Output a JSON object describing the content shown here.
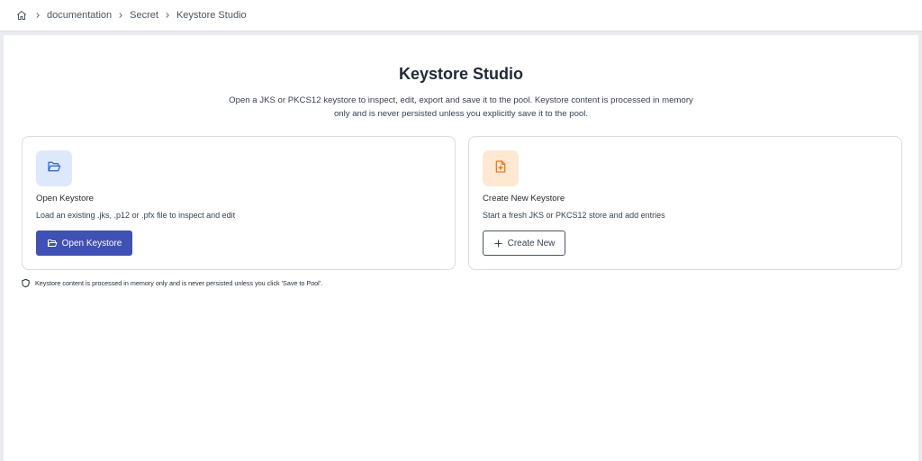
{
  "breadcrumb": {
    "home_icon": "home-icon",
    "items": [
      "documentation",
      "Secret",
      "Keystore Studio"
    ]
  },
  "page": {
    "title": "Keystore Studio",
    "description": "Open a JKS or PKCS12 keystore to inspect, edit, export and save it to the pool. Keystore content is processed in memory only and is never persisted unless you explicitly save it to the pool."
  },
  "cards": {
    "open": {
      "icon": "folder-open-icon",
      "title": "Open Keystore",
      "description": "Load an existing .jks, .p12 or .pfx file to inspect and edit",
      "button_label": "Open Keystore",
      "button_icon": "folder-open-icon",
      "accent": "#3f51b5",
      "tile_color": "#dde9fb"
    },
    "create": {
      "icon": "file-plus-icon",
      "title": "Create New Keystore",
      "description": "Start a fresh JKS or PKCS12 store and add entries",
      "button_label": "Create New",
      "button_icon": "plus-icon",
      "icon_color": "#ea7b1f",
      "tile_color": "#fde8d2"
    }
  },
  "notice": {
    "icon": "shield-icon",
    "text": "Keystore content is processed in memory only and is never persisted unless you click 'Save to Pool'."
  }
}
